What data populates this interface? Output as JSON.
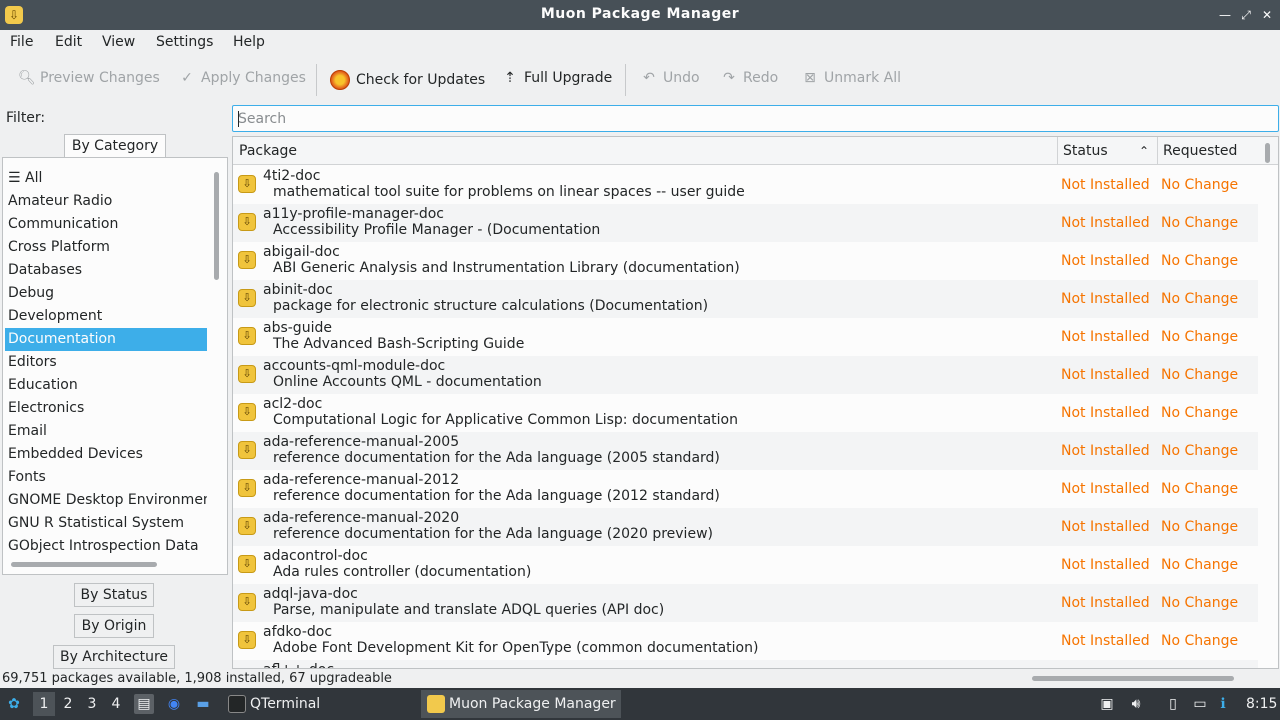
{
  "window": {
    "title": "Muon Package Manager",
    "icon": "package-icon",
    "controls": [
      "minimize-icon",
      "maximize-icon",
      "close-icon"
    ]
  },
  "menubar": [
    "File",
    "Edit",
    "View",
    "Settings",
    "Help"
  ],
  "toolbar": {
    "preview": {
      "label": "Preview Changes",
      "icon": "search-icon",
      "enabled": false
    },
    "apply": {
      "label": "Apply Changes",
      "icon": "check-icon",
      "enabled": false
    },
    "check": {
      "label": "Check for Updates",
      "icon": "refresh-icon",
      "enabled": true
    },
    "upgrade": {
      "label": "Full Upgrade",
      "icon": "upgrade-icon",
      "enabled": true
    },
    "undo": {
      "label": "Undo",
      "icon": "undo-icon",
      "enabled": false
    },
    "redo": {
      "label": "Redo",
      "icon": "redo-icon",
      "enabled": false
    },
    "unmark": {
      "label": "Unmark All",
      "icon": "unmark-icon",
      "enabled": false
    }
  },
  "filter": {
    "label": "Filter:",
    "tabs": {
      "category": "By Category",
      "status": "By Status",
      "origin": "By Origin",
      "architecture": "By Architecture"
    },
    "categories": [
      "All",
      "Amateur Radio",
      "Communication",
      "Cross Platform",
      "Databases",
      "Debug",
      "Development",
      "Documentation",
      "Editors",
      "Education",
      "Electronics",
      "Email",
      "Embedded Devices",
      "Fonts",
      "GNOME Desktop Environment",
      "GNU R Statistical System",
      "GObject Introspection Data"
    ],
    "selected_category": "Documentation"
  },
  "search": {
    "placeholder": "Search",
    "value": ""
  },
  "table": {
    "columns": {
      "package": "Package",
      "status": "Status",
      "requested": "Requested"
    },
    "rows": [
      {
        "name": "4ti2-doc",
        "desc": "mathematical tool suite for problems on linear spaces -- user guide",
        "status": "Not Installed",
        "requested": "No Change"
      },
      {
        "name": "a11y-profile-manager-doc",
        "desc": "Accessibility Profile Manager - (Documentation",
        "status": "Not Installed",
        "requested": "No Change"
      },
      {
        "name": "abigail-doc",
        "desc": "ABI Generic Analysis and Instrumentation Library (documentation)",
        "status": "Not Installed",
        "requested": "No Change"
      },
      {
        "name": "abinit-doc",
        "desc": "package for electronic structure calculations (Documentation)",
        "status": "Not Installed",
        "requested": "No Change"
      },
      {
        "name": "abs-guide",
        "desc": "The Advanced Bash-Scripting Guide",
        "status": "Not Installed",
        "requested": "No Change"
      },
      {
        "name": "accounts-qml-module-doc",
        "desc": "Online Accounts QML - documentation",
        "status": "Not Installed",
        "requested": "No Change"
      },
      {
        "name": "acl2-doc",
        "desc": "Computational Logic for Applicative Common Lisp: documentation",
        "status": "Not Installed",
        "requested": "No Change"
      },
      {
        "name": "ada-reference-manual-2005",
        "desc": "reference documentation for the Ada language (2005 standard)",
        "status": "Not Installed",
        "requested": "No Change"
      },
      {
        "name": "ada-reference-manual-2012",
        "desc": "reference documentation for the Ada language (2012 standard)",
        "status": "Not Installed",
        "requested": "No Change"
      },
      {
        "name": "ada-reference-manual-2020",
        "desc": "reference documentation for the Ada language (2020 preview)",
        "status": "Not Installed",
        "requested": "No Change"
      },
      {
        "name": "adacontrol-doc",
        "desc": "Ada rules controller (documentation)",
        "status": "Not Installed",
        "requested": "No Change"
      },
      {
        "name": "adql-java-doc",
        "desc": "Parse, manipulate and translate ADQL queries (API doc)",
        "status": "Not Installed",
        "requested": "No Change"
      },
      {
        "name": "afdko-doc",
        "desc": "Adobe Font Development Kit for OpenType (common documentation)",
        "status": "Not Installed",
        "requested": "No Change"
      },
      {
        "name": "afl++-doc",
        "desc": "",
        "status": "",
        "requested": ""
      }
    ]
  },
  "statusbar": {
    "text": "69,751 packages available, 1,908 installed, 67 upgradeable"
  },
  "taskbar": {
    "desktops": [
      "1",
      "2",
      "3",
      "4"
    ],
    "tasks": {
      "terminal": "QTerminal",
      "muon": "Muon Package Manager"
    },
    "clock": "8:15"
  },
  "colors": {
    "accent": "#3daee9",
    "status_text": "#f67400",
    "taskbar": "#31363b",
    "titlebar": "#475057"
  }
}
